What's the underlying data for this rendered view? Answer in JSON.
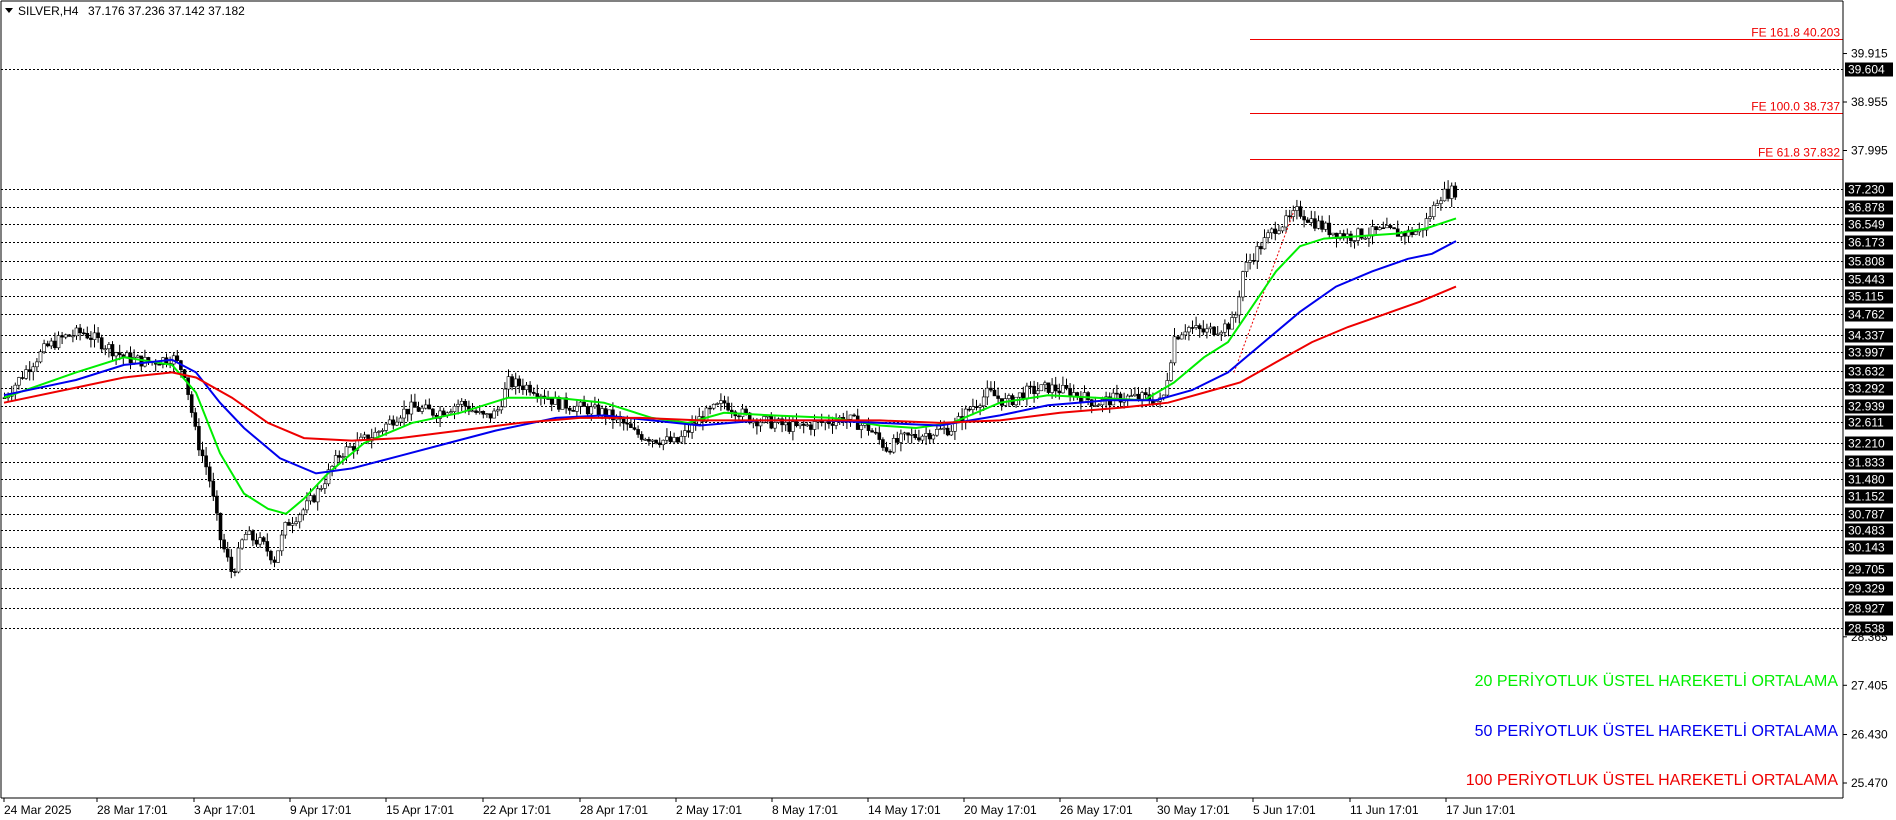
{
  "header": {
    "symbol": "SILVER,H4",
    "ohlc": "37.176 37.236 37.142 37.182"
  },
  "legend": [
    {
      "text": "20 PERİYOTLUK ÜSTEL HAREKETLİ ORTALAMA",
      "color": "#00ee00"
    },
    {
      "text": "50 PERİYOTLUK ÜSTEL HAREKETLİ ORTALAMA",
      "color": "#0000ee"
    },
    {
      "text": "100 PERİYOTLUK ÜSTEL HAREKETLİ ORTALAMA",
      "color": "#ee0000"
    }
  ],
  "fibonacci": [
    {
      "label": "FE 161.8 40.203",
      "value": 40.203
    },
    {
      "label": "FE 100.0 38.737",
      "value": 38.737
    },
    {
      "label": "FE 61.8 37.832",
      "value": 37.832
    }
  ],
  "chart_data": {
    "type": "candlestick",
    "ylim": [
      24.9,
      40.8
    ],
    "y_axis_ticks": [
      "39.915",
      "38.955",
      "37.995",
      "28.365",
      "27.405",
      "26.430",
      "25.470"
    ],
    "x_tick_labels": [
      "24 Mar 2025",
      "28 Mar 17:01",
      "3 Apr 17:01",
      "9 Apr 17:01",
      "15 Apr 17:01",
      "22 Apr 17:01",
      "28 Apr 17:01",
      "2 May 17:01",
      "8 May 17:01",
      "14 May 17:01",
      "20 May 17:01",
      "26 May 17:01",
      "30 May 17:01",
      "5 Jun 17:01",
      "11 Jun 17:01",
      "17 Jun 17:01"
    ],
    "levels": [
      "39.604",
      "37.230",
      "36.878",
      "36.549",
      "36.173",
      "35.808",
      "35.443",
      "35.115",
      "34.762",
      "34.337",
      "33.997",
      "33.632",
      "33.292",
      "32.939",
      "32.611",
      "32.210",
      "31.833",
      "31.480",
      "31.152",
      "30.787",
      "30.483",
      "30.143",
      "29.705",
      "29.329",
      "28.927",
      "28.538"
    ],
    "price_path": [
      [
        0,
        33.1
      ],
      [
        10,
        33.4
      ],
      [
        20,
        33.7
      ],
      [
        35,
        34.1
      ],
      [
        50,
        34.3
      ],
      [
        65,
        34.4
      ],
      [
        80,
        34.2
      ],
      [
        100,
        33.9
      ],
      [
        120,
        33.8
      ],
      [
        140,
        33.9
      ],
      [
        150,
        33.6
      ],
      [
        160,
        32.3
      ],
      [
        170,
        31.6
      ],
      [
        180,
        30.3
      ],
      [
        190,
        29.6
      ],
      [
        200,
        30.4
      ],
      [
        215,
        30.2
      ],
      [
        225,
        29.9
      ],
      [
        235,
        30.6
      ],
      [
        250,
        30.9
      ],
      [
        260,
        31.2
      ],
      [
        270,
        31.6
      ],
      [
        280,
        32.0
      ],
      [
        295,
        32.2
      ],
      [
        310,
        32.4
      ],
      [
        330,
        32.8
      ],
      [
        340,
        32.9
      ],
      [
        360,
        32.8
      ],
      [
        380,
        33.0
      ],
      [
        400,
        32.7
      ],
      [
        410,
        32.8
      ],
      [
        420,
        33.4
      ],
      [
        440,
        33.3
      ],
      [
        460,
        33.0
      ],
      [
        480,
        32.9
      ],
      [
        500,
        32.8
      ],
      [
        515,
        32.6
      ],
      [
        525,
        32.4
      ],
      [
        540,
        32.3
      ],
      [
        560,
        32.2
      ],
      [
        580,
        32.7
      ],
      [
        600,
        33.0
      ],
      [
        620,
        32.7
      ],
      [
        640,
        32.6
      ],
      [
        660,
        32.5
      ],
      [
        680,
        32.6
      ],
      [
        700,
        32.7
      ],
      [
        720,
        32.5
      ],
      [
        735,
        32.1
      ],
      [
        750,
        32.3
      ],
      [
        770,
        32.4
      ],
      [
        790,
        32.5
      ],
      [
        805,
        32.9
      ],
      [
        820,
        33.2
      ],
      [
        835,
        33.0
      ],
      [
        850,
        33.2
      ],
      [
        870,
        33.3
      ],
      [
        890,
        33.2
      ],
      [
        910,
        33.0
      ],
      [
        930,
        33.1
      ],
      [
        950,
        33.1
      ],
      [
        965,
        33.0
      ],
      [
        975,
        34.3
      ],
      [
        985,
        34.5
      ],
      [
        1000,
        34.4
      ],
      [
        1015,
        34.5
      ],
      [
        1025,
        34.6
      ],
      [
        1032,
        35.6
      ],
      [
        1040,
        35.9
      ],
      [
        1050,
        36.2
      ],
      [
        1060,
        36.5
      ],
      [
        1070,
        36.6
      ],
      [
        1078,
        36.8
      ],
      [
        1090,
        36.6
      ],
      [
        1105,
        36.4
      ],
      [
        1120,
        36.3
      ],
      [
        1135,
        36.35
      ],
      [
        1150,
        36.4
      ],
      [
        1165,
        36.35
      ],
      [
        1180,
        36.4
      ],
      [
        1190,
        36.8
      ],
      [
        1195,
        37.1
      ],
      [
        1205,
        37.18
      ],
      [
        1210,
        37.2
      ]
    ],
    "ema20": [
      [
        0,
        33.1
      ],
      [
        60,
        33.6
      ],
      [
        100,
        33.9
      ],
      [
        140,
        33.75
      ],
      [
        160,
        33.2
      ],
      [
        180,
        32.0
      ],
      [
        200,
        31.2
      ],
      [
        220,
        30.9
      ],
      [
        235,
        30.8
      ],
      [
        250,
        31.1
      ],
      [
        270,
        31.6
      ],
      [
        300,
        32.2
      ],
      [
        340,
        32.6
      ],
      [
        380,
        32.8
      ],
      [
        420,
        33.1
      ],
      [
        460,
        33.1
      ],
      [
        500,
        33.0
      ],
      [
        540,
        32.7
      ],
      [
        570,
        32.6
      ],
      [
        600,
        32.8
      ],
      [
        640,
        32.75
      ],
      [
        690,
        32.7
      ],
      [
        730,
        32.55
      ],
      [
        760,
        32.5
      ],
      [
        790,
        32.6
      ],
      [
        830,
        33.0
      ],
      [
        870,
        33.15
      ],
      [
        910,
        33.1
      ],
      [
        950,
        33.05
      ],
      [
        975,
        33.4
      ],
      [
        1000,
        33.9
      ],
      [
        1020,
        34.2
      ],
      [
        1040,
        34.9
      ],
      [
        1060,
        35.6
      ],
      [
        1080,
        36.1
      ],
      [
        1100,
        36.25
      ],
      [
        1130,
        36.3
      ],
      [
        1160,
        36.35
      ],
      [
        1185,
        36.45
      ],
      [
        1210,
        36.65
      ]
    ],
    "ema50": [
      [
        0,
        33.15
      ],
      [
        60,
        33.45
      ],
      [
        100,
        33.75
      ],
      [
        140,
        33.85
      ],
      [
        160,
        33.6
      ],
      [
        180,
        33.0
      ],
      [
        200,
        32.5
      ],
      [
        230,
        31.9
      ],
      [
        260,
        31.6
      ],
      [
        290,
        31.7
      ],
      [
        330,
        31.95
      ],
      [
        370,
        32.2
      ],
      [
        410,
        32.45
      ],
      [
        460,
        32.7
      ],
      [
        500,
        32.75
      ],
      [
        540,
        32.65
      ],
      [
        580,
        32.55
      ],
      [
        630,
        32.65
      ],
      [
        680,
        32.65
      ],
      [
        730,
        32.6
      ],
      [
        780,
        32.55
      ],
      [
        830,
        32.75
      ],
      [
        870,
        32.95
      ],
      [
        920,
        33.05
      ],
      [
        960,
        33.05
      ],
      [
        990,
        33.25
      ],
      [
        1020,
        33.6
      ],
      [
        1050,
        34.2
      ],
      [
        1080,
        34.8
      ],
      [
        1110,
        35.3
      ],
      [
        1140,
        35.6
      ],
      [
        1170,
        35.85
      ],
      [
        1190,
        35.95
      ],
      [
        1210,
        36.2
      ]
    ],
    "ema100": [
      [
        0,
        33.0
      ],
      [
        60,
        33.3
      ],
      [
        100,
        33.5
      ],
      [
        140,
        33.6
      ],
      [
        160,
        33.5
      ],
      [
        190,
        33.1
      ],
      [
        220,
        32.6
      ],
      [
        250,
        32.3
      ],
      [
        290,
        32.25
      ],
      [
        330,
        32.3
      ],
      [
        380,
        32.45
      ],
      [
        430,
        32.6
      ],
      [
        480,
        32.7
      ],
      [
        530,
        32.7
      ],
      [
        580,
        32.65
      ],
      [
        630,
        32.65
      ],
      [
        680,
        32.65
      ],
      [
        730,
        32.65
      ],
      [
        780,
        32.6
      ],
      [
        830,
        32.65
      ],
      [
        880,
        32.8
      ],
      [
        930,
        32.9
      ],
      [
        970,
        33.0
      ],
      [
        1000,
        33.2
      ],
      [
        1030,
        33.4
      ],
      [
        1060,
        33.8
      ],
      [
        1090,
        34.2
      ],
      [
        1120,
        34.5
      ],
      [
        1150,
        34.75
      ],
      [
        1180,
        35.0
      ],
      [
        1210,
        35.3
      ]
    ]
  }
}
